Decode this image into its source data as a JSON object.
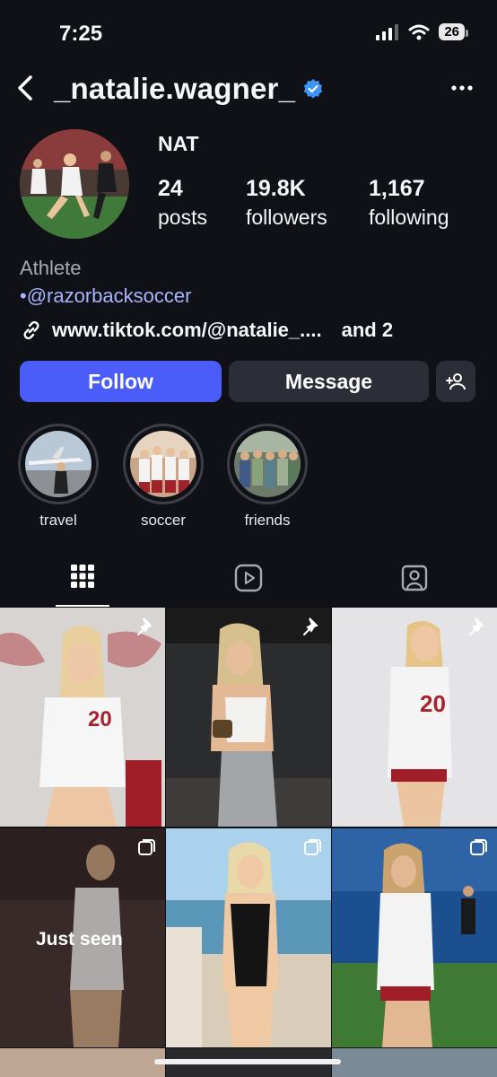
{
  "status": {
    "time": "7:25",
    "battery": "26"
  },
  "profile": {
    "username": "_natalie.wagner_",
    "display_name": "NAT",
    "stats": [
      {
        "value": "24",
        "label": "posts"
      },
      {
        "value": "19.8K",
        "label": "followers"
      },
      {
        "value": "1,167",
        "label": "following"
      }
    ],
    "bio_category": "Athlete",
    "bio_mention": "•@razorbacksoccer",
    "bio_link": "www.tiktok.com/@natalie_....",
    "bio_link_more": "and 2"
  },
  "actions": {
    "follow": "Follow",
    "message": "Message"
  },
  "highlights": [
    {
      "label": "travel"
    },
    {
      "label": "soccer"
    },
    {
      "label": "friends"
    }
  ],
  "grid": {
    "just_seen": "Just seen"
  },
  "colors": {
    "accent": "#4a5df9",
    "mention": "#a9b4ff",
    "verified": "#3f95f6",
    "background": "#0f1116"
  },
  "icons": [
    "back-icon",
    "verified-icon",
    "more-icon",
    "link-icon",
    "add-person-icon",
    "grid-icon",
    "reels-icon",
    "tagged-icon",
    "pin-icon",
    "carousel-icon"
  ]
}
